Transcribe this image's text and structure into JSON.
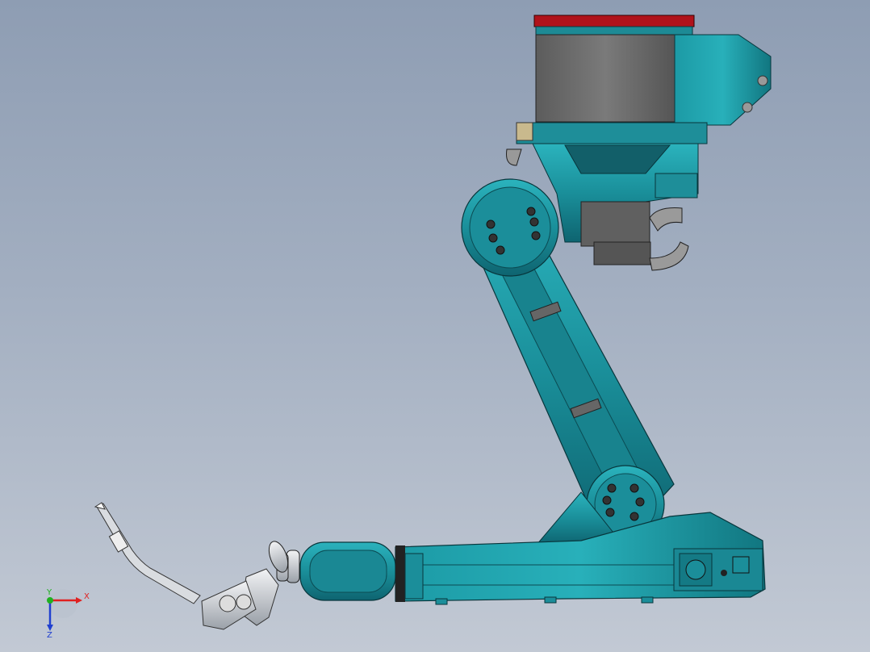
{
  "triad": {
    "x_label": "X",
    "y_label": "Y",
    "z_label": "Z",
    "x_color": "#e02020",
    "y_color": "#20b020",
    "z_color": "#2040d0"
  },
  "model": {
    "body_color": "#1b8e9a",
    "body_dark": "#0f6670",
    "motor_color": "#6e6e6e",
    "cap_color": "#b0121a",
    "tool_color": "#c8cbd0"
  },
  "icons": [
    "robot-arm-model",
    "coordinate-triad-icon"
  ]
}
